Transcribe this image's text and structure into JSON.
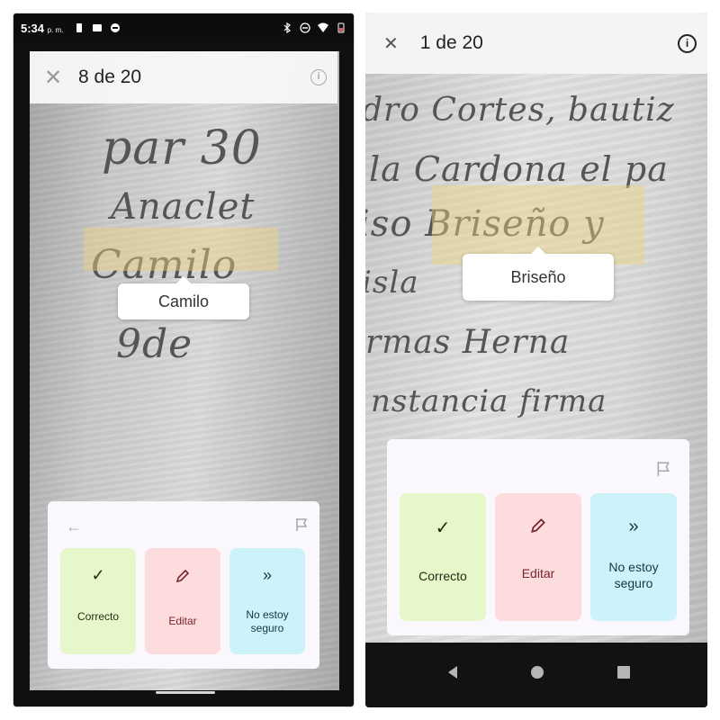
{
  "left": {
    "status_bar": {
      "time": "5:34",
      "ampm": "p. m."
    },
    "header": {
      "counter": "8 de 20"
    },
    "highlight_word": "Camilo",
    "tooltip": "Camilo",
    "handwriting": [
      "par 30",
      "Anaclet",
      "Camilo",
      "9de"
    ],
    "actions": [
      {
        "label": "Correcto"
      },
      {
        "label": "Editar"
      },
      {
        "label": "No estoy seguro"
      }
    ]
  },
  "right": {
    "header": {
      "counter": "1 de 20"
    },
    "highlight_word": "Briseño",
    "tooltip": "Briseño",
    "handwriting": [
      "dro Cortes, bautiz",
      "la Cardona el pa",
      "iso Briseño y",
      "isla",
      "rmas Herna",
      "nstancia firma"
    ],
    "actions": [
      {
        "label": "Correcto"
      },
      {
        "label": "Editar"
      },
      {
        "label": "No estoy seguro"
      }
    ]
  },
  "icons": {
    "close": "close-icon",
    "info": "info-icon",
    "back": "arrow-left-icon",
    "flag": "flag-icon",
    "check": "check-icon",
    "pencil": "pencil-icon",
    "skip": "double-chevron-icon"
  },
  "colors": {
    "correcto_bg": "#e6f8c9",
    "editar_bg": "#fcdcdc",
    "unsure_bg": "#ccf3fa",
    "highlight": "#ecd278"
  }
}
